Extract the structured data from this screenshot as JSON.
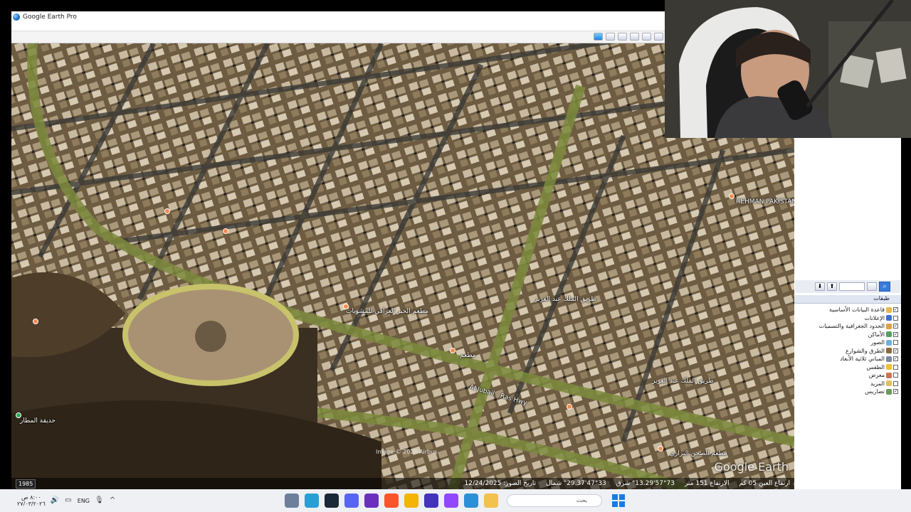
{
  "window": {
    "title": "Google Earth Pro"
  },
  "map": {
    "labels": {
      "street_1": "طريق الملك عبد العزيز",
      "street_2": "طريق الملك عبد العزيز",
      "restaurant_1": "مطعم الخير العراقي للمشويات",
      "restaurant_2": "مطعم الصحن البراري",
      "pakistani": "REHMAN PAKISTANI R",
      "park": "حديقة المطار",
      "highway": "Al Jubail - Ras Hwy",
      "bldg": "مطعم"
    },
    "imagery_credit": "Image © 2026 Airbus",
    "brand": "Google Earth",
    "year_badge": "1985"
  },
  "statusbar": {
    "date": "تاريخ الصور: 12/24/2025",
    "lat": "47°33'29.37\" شمال",
    "lon": "57°73'13.29\" شرق",
    "elev": "الارتفاع 151 متر",
    "eye": "ارتفاع العين 05 كم"
  },
  "sidepanel": {
    "layers_title": "طبقات",
    "layers": [
      {
        "label": "قاعدة البيانات الأساسية",
        "checked": true
      },
      {
        "label": "الإعلانات",
        "checked": false
      },
      {
        "label": "الحدود الجغرافية والتسميات",
        "checked": true
      },
      {
        "label": "الأماكن",
        "checked": true
      },
      {
        "label": "الصور",
        "checked": false
      },
      {
        "label": "الطرق والشوارع",
        "checked": true
      },
      {
        "label": "المباني ثلاثية الأبعاد",
        "checked": true
      },
      {
        "label": "الطقس",
        "checked": false
      },
      {
        "label": "معرض",
        "checked": false
      },
      {
        "label": "المزيد",
        "checked": false
      },
      {
        "label": "تضاريس",
        "checked": true
      }
    ]
  },
  "taskbar": {
    "time": "٨:٠٠ ص",
    "date": "٢٧/٠٣/٢٠٢٦",
    "lang": "ENG",
    "search_placeholder": "بحث"
  }
}
